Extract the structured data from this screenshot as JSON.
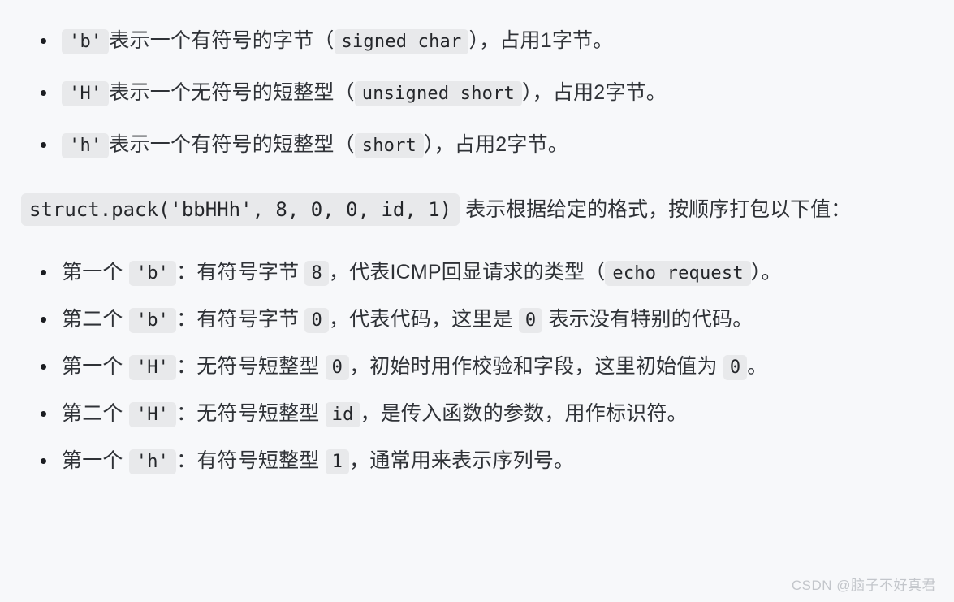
{
  "theme": {
    "background": "#f7f8fa",
    "text_color": "#2f3237",
    "code_background": "#e8e9eb",
    "code_text": "#24262a",
    "watermark_color": "#c3c6cb"
  },
  "format_list": [
    {
      "code": "'b'",
      "text_before": "表示一个有符号的字节（",
      "type_code": "signed char",
      "text_after": "），占用1字节。"
    },
    {
      "code": "'H'",
      "text_before": "表示一个无符号的短整型（",
      "type_code": "unsigned short",
      "text_after": "），占用2字节。"
    },
    {
      "code": "'h'",
      "text_before": "表示一个有符号的短整型（",
      "type_code": "short",
      "text_after": "），占用2字节。"
    }
  ],
  "paragraph": {
    "code": "struct.pack('bbHHh', 8, 0, 0, id, 1)",
    "text": " 表示根据给定的格式，按顺序打包以下值："
  },
  "value_list": [
    {
      "prefix": "第一个 ",
      "format_code": "'b'",
      "mid": "：有符号字节 ",
      "value_code": "8",
      "text": "，代表ICMP回显请求的类型（",
      "trailing_code": "echo request",
      "tail": "）。"
    },
    {
      "prefix": "第二个 ",
      "format_code": "'b'",
      "mid": "：有符号字节 ",
      "value_code": "0",
      "text": "，代表代码，这里是 ",
      "trailing_code": "0",
      "tail": " 表示没有特别的代码。"
    },
    {
      "prefix": "第一个 ",
      "format_code": "'H'",
      "mid": "：无符号短整型 ",
      "value_code": "0",
      "text": "，初始时用作校验和字段，这里初始值为 ",
      "trailing_code": "0",
      "tail": "。"
    },
    {
      "prefix": "第二个 ",
      "format_code": "'H'",
      "mid": "：无符号短整型 ",
      "value_code": "id",
      "text": "，是传入函数的参数，用作标识符。",
      "trailing_code": "",
      "tail": ""
    },
    {
      "prefix": "第一个 ",
      "format_code": "'h'",
      "mid": "：有符号短整型 ",
      "value_code": "1",
      "text": "，通常用来表示序列号。",
      "trailing_code": "",
      "tail": ""
    }
  ],
  "watermark": "CSDN @脑子不好真君"
}
